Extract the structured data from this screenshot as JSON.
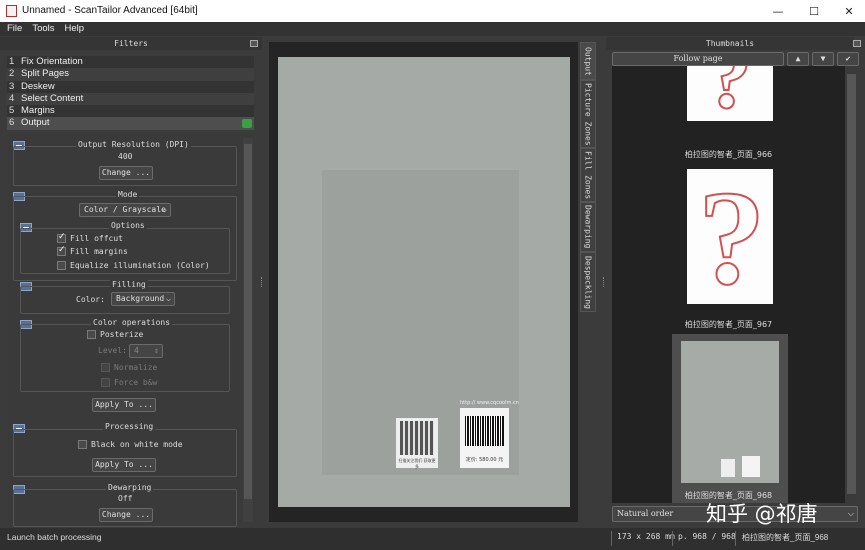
{
  "window": {
    "title": "Unnamed - ScanTailor Advanced [64bit]",
    "minimize": "—",
    "maximize": "☐",
    "close": "✕"
  },
  "menu": [
    "File",
    "Tools",
    "Help"
  ],
  "filters_panel": {
    "title": "Filters",
    "items": [
      {
        "num": "1",
        "label": "Fix Orientation"
      },
      {
        "num": "2",
        "label": "Split Pages"
      },
      {
        "num": "3",
        "label": "Deskew"
      },
      {
        "num": "4",
        "label": "Select Content"
      },
      {
        "num": "5",
        "label": "Margins"
      },
      {
        "num": "6",
        "label": "Output"
      }
    ],
    "selected_index": 5,
    "ok_color": "#3aa041"
  },
  "output_options": {
    "resolution": {
      "title": "Output Resolution (DPI)",
      "value": "400",
      "change": "Change ..."
    },
    "mode": {
      "title": "Mode",
      "selected": "Color / Grayscale"
    },
    "options": {
      "title": "Options",
      "fill_offcut": "Fill offcut",
      "fill_margins": "Fill margins",
      "equalize": "Equalize illumination (Color)"
    },
    "filling": {
      "title": "Filling",
      "color_label": "Color:",
      "color_value": "Background"
    },
    "color_ops": {
      "title": "Color operations",
      "posterize": "Posterize",
      "level_label": "Level:",
      "level_value": "4",
      "normalize": "Normalize",
      "force_bw": "Force b&w",
      "apply": "Apply To ..."
    },
    "processing": {
      "title": "Processing",
      "black_on_white": "Black on white mode",
      "apply": "Apply To ..."
    },
    "dewarping": {
      "title": "Dewarping",
      "value": "Off",
      "change": "Change ..."
    }
  },
  "scan": {
    "url": "http:// www.cqcoolm.cn",
    "qr_caption": "扫描关注我们 获取更多",
    "price": "定价: 580.00 元"
  },
  "view_tabs": [
    "Output",
    "Picture Zones",
    "Fill Zones",
    "Dewarping",
    "Despeckling"
  ],
  "thumbnails_panel": {
    "title": "Thumbnails",
    "follow": "Follow page",
    "up": "▲",
    "down": "▼",
    "check": "✔",
    "pages": [
      "柏拉图的智者_页面_966",
      "柏拉图的智者_页面_967",
      "柏拉图的智者_页面_968"
    ],
    "order": "Natural order"
  },
  "status": {
    "left": "Launch batch processing",
    "size": "173 x 268 mm",
    "page": "p. 968 / 968",
    "file": "柏拉图的智者_页面_968"
  },
  "watermark": "知乎 @祁唐"
}
